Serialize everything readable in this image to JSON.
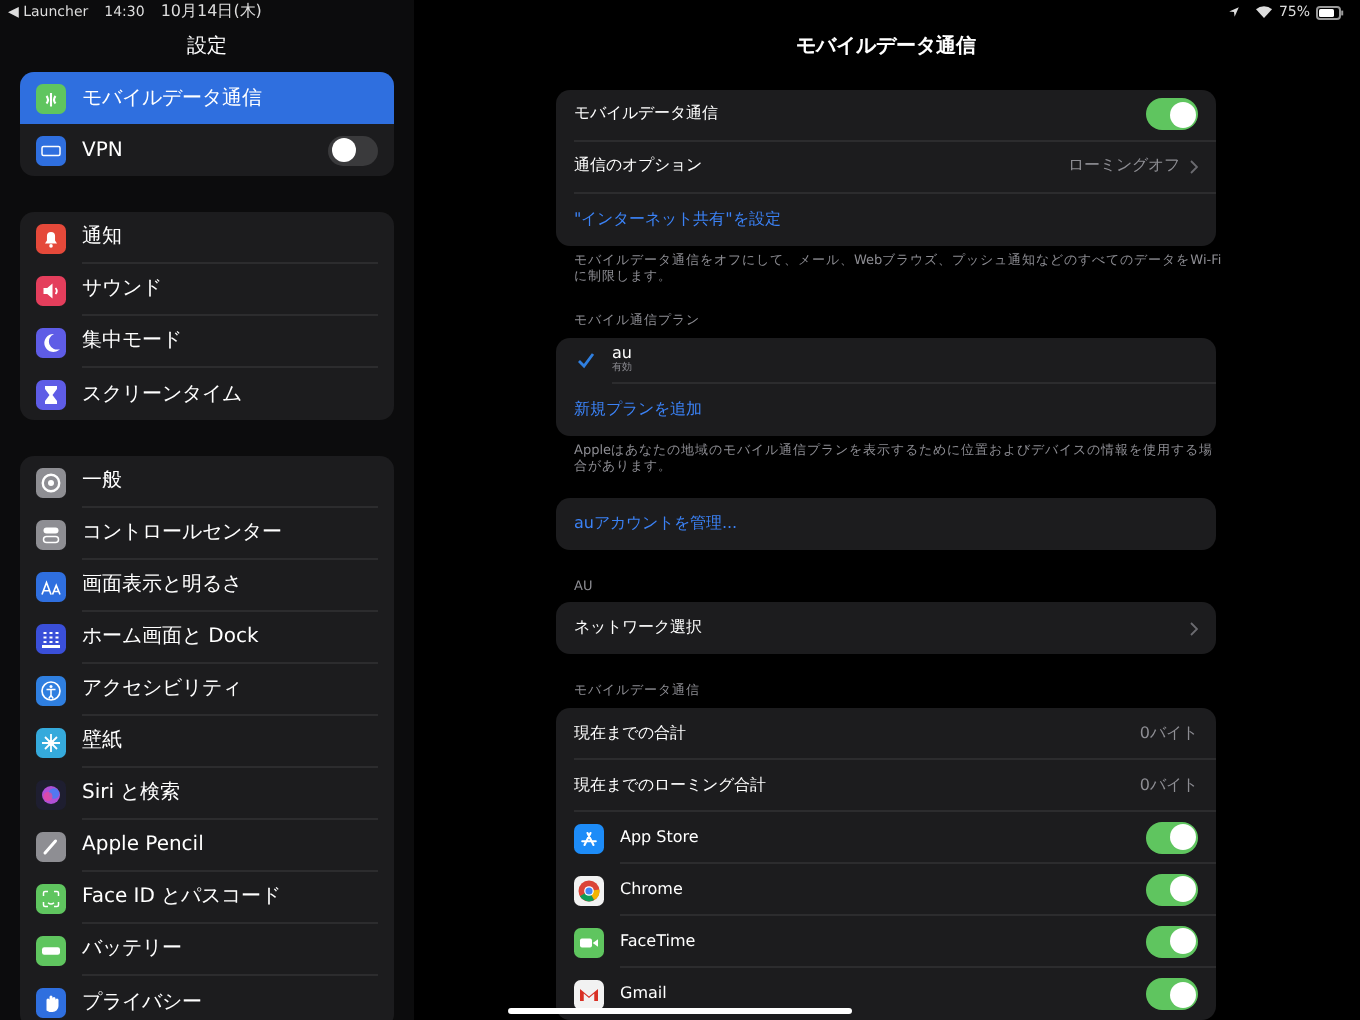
{
  "status_bar": {
    "back": "◀ Launcher",
    "time": "14:30",
    "date": "10月14日(木)",
    "battery": "75%"
  },
  "sidebar": {
    "title": "設定",
    "groups": [
      {
        "items": [
          {
            "label": "モバイルデータ通信",
            "selected": true
          },
          {
            "label": "VPN",
            "selected": false,
            "kind": "toggle",
            "on": false
          }
        ]
      },
      {
        "items": [
          {
            "label": "通知",
            "selected": false
          },
          {
            "label": "サウンド",
            "selected": false
          },
          {
            "label": "集中モード",
            "selected": false
          },
          {
            "label": "スクリーンタイム",
            "selected": false
          }
        ]
      },
      {
        "items": [
          {
            "label": "一般",
            "selected": false
          },
          {
            "label": "コントロールセンター",
            "selected": false
          },
          {
            "label": "画面表示と明るさ",
            "selected": false
          },
          {
            "label": "ホーム画面と Dock",
            "selected": false
          },
          {
            "label": "アクセシビリティ",
            "selected": false
          },
          {
            "label": "壁紙",
            "selected": false
          },
          {
            "label": "Siri と検索",
            "selected": false
          },
          {
            "label": "Apple Pencil",
            "selected": false
          },
          {
            "label": "Face ID とパスコード",
            "selected": false
          },
          {
            "label": "バッテリー",
            "selected": false
          },
          {
            "label": "プライバシー",
            "selected": false
          }
        ]
      }
    ]
  },
  "detail": {
    "title": "モバイルデータ通信",
    "sections": [
      {
        "rows": [
          {
            "kind": "toggle",
            "label": "モバイルデータ通信",
            "on": true
          },
          {
            "kind": "value",
            "label": "通信のオプション",
            "value": "ローミングオフ"
          },
          {
            "kind": "link",
            "label": "\"インターネット共有\"を設定"
          }
        ],
        "footer": "モバイルデータ通信をオフにして、メール、Webブラウズ、プッシュ通知などのすべてのデータをWi-Fiに制限します。"
      },
      {
        "header": "モバイル通信プラン",
        "rows": [
          {
            "kind": "plan",
            "label": "au",
            "sublabel": "有効",
            "checked": true
          },
          {
            "kind": "link",
            "label": "新規プランを追加"
          }
        ],
        "footer": "Appleはあなたの地域のモバイル通信プランを表示するために位置およびデバイスの情報を使用する場合があります。"
      },
      {
        "rows": [
          {
            "kind": "link",
            "label": "auアカウントを管理..."
          }
        ]
      },
      {
        "header": "AU",
        "rows": [
          {
            "kind": "value",
            "label": "ネットワーク選択"
          }
        ]
      },
      {
        "header": "モバイルデータ通信",
        "rows": [
          {
            "kind": "stat",
            "label": "現在までの合計",
            "value": "0バイト"
          },
          {
            "kind": "stat",
            "label": "現在までのローミング合計",
            "value": "0バイト"
          },
          {
            "kind": "app",
            "label": "App Store",
            "on": true
          },
          {
            "kind": "app",
            "label": "Chrome",
            "on": true
          },
          {
            "kind": "app",
            "label": "FaceTime",
            "on": true
          },
          {
            "kind": "app",
            "label": "Gmail",
            "on": true
          }
        ]
      }
    ]
  }
}
